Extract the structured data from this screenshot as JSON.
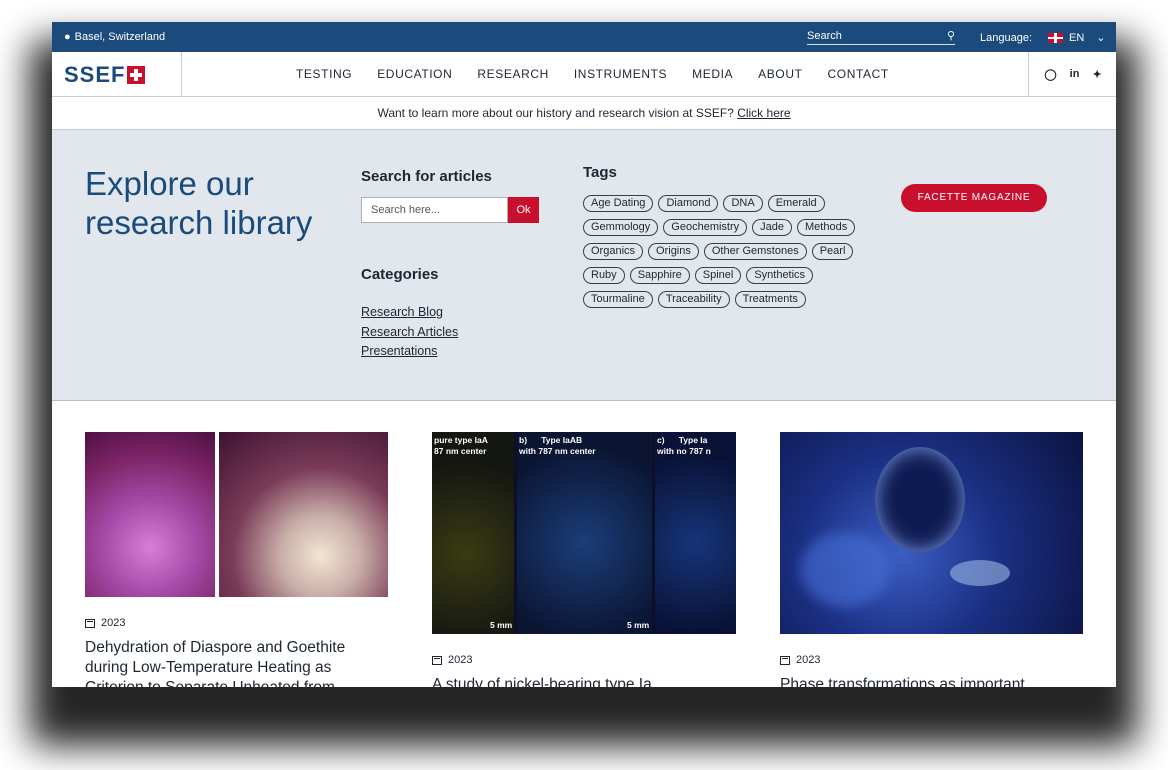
{
  "topbar": {
    "location": "Basel, Switzerland",
    "search_placeholder": "Search",
    "language_label": "Language:",
    "language_value": "EN"
  },
  "nav": {
    "logo": "SSEF",
    "items": [
      "TESTING",
      "EDUCATION",
      "RESEARCH",
      "INSTRUMENTS",
      "MEDIA",
      "ABOUT",
      "CONTACT"
    ],
    "social": [
      "instagram-icon",
      "linkedin-icon",
      "twitter-icon"
    ]
  },
  "promo": {
    "text": "Want to learn more about our history and research vision at SSEF?",
    "link": "Click here"
  },
  "hero": {
    "title": "Explore our research library",
    "search_heading": "Search for articles",
    "search_placeholder": "Search here...",
    "search_button": "Ok",
    "categories_heading": "Categories",
    "categories": [
      "Research Blog",
      "Research Articles",
      "Presentations"
    ],
    "tags_heading": "Tags",
    "tags": [
      "Age Dating",
      "Diamond",
      "DNA",
      "Emerald",
      "Gemmology",
      "Geochemistry",
      "Jade",
      "Methods",
      "Organics",
      "Origins",
      "Other Gemstones",
      "Pearl",
      "Ruby",
      "Sapphire",
      "Spinel",
      "Synthetics",
      "Tourmaline",
      "Traceability",
      "Treatments"
    ],
    "magazine_button": "FACETTE MAGAZINE"
  },
  "cards": [
    {
      "year": "2023",
      "title": "Dehydration of Diaspore and Goethite during Low-Temperature Heating as Criterion to Separate Unheated from"
    },
    {
      "year": "2023",
      "title": "A study of nickel-bearing type Ia",
      "image_labels": [
        "pure type IaA\n87 nm center",
        "b)      Type IaAB\nwith 787 nm center",
        "c)      Type Ia\nwith no 787 n"
      ],
      "scale_label": "5 mm"
    },
    {
      "year": "2023",
      "title": "Phase transformations as important"
    }
  ]
}
